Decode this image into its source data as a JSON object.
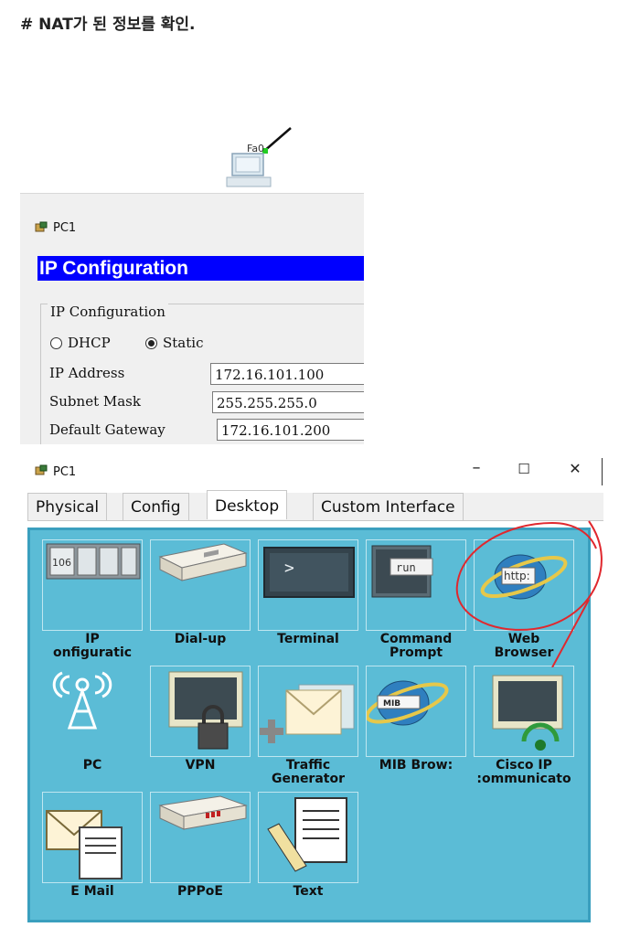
{
  "heading": "# NAT가 된 정보를 확인.",
  "topology": {
    "port_label": "Fa0"
  },
  "ip_window": {
    "title": "PC1",
    "banner": "IP Configuration",
    "group_label": "IP Configuration",
    "dhcp_label": "DHCP",
    "static_label": "Static",
    "mode_selected": "Static",
    "fields": [
      {
        "label": "IP Address",
        "value": "172.16.101.100"
      },
      {
        "label": "Subnet Mask",
        "value": "255.255.255.0"
      },
      {
        "label": "Default Gateway",
        "value": "172.16.101.200"
      }
    ]
  },
  "desktop_window": {
    "title": "PC1",
    "controls": {
      "minimize": "–",
      "maximize": "☐",
      "close": "✕"
    },
    "tabs": [
      {
        "label": "Physical"
      },
      {
        "label": "Config"
      },
      {
        "label": "Desktop"
      },
      {
        "label": "Custom Interface"
      }
    ],
    "active_tab": "Desktop",
    "apps": [
      {
        "label": "IP\nonfiguratic",
        "icon": "ip-configuration-icon"
      },
      {
        "label": "Dial-up",
        "icon": "dial-up-icon"
      },
      {
        "label": "Terminal",
        "icon": "terminal-icon"
      },
      {
        "label": "Command\nPrompt",
        "icon": "command-prompt-icon"
      },
      {
        "label": "Web\nBrowser",
        "icon": "web-browser-icon"
      },
      {
        "label": "PC",
        "icon": "pc-wireless-icon"
      },
      {
        "label": "VPN",
        "icon": "vpn-icon"
      },
      {
        "label": "Traffic\nGenerator",
        "icon": "traffic-generator-icon"
      },
      {
        "label": "MIB Brow:",
        "icon": "mib-browser-icon"
      },
      {
        "label": "Cisco IP\n:ommunicato",
        "icon": "cisco-ip-communicator-icon"
      },
      {
        "label": "E Mail",
        "icon": "email-icon"
      },
      {
        "label": "PPPoE",
        "icon": "pppoe-icon"
      },
      {
        "label": "Text",
        "icon": "text-editor-icon"
      }
    ]
  },
  "colors": {
    "banner": "#0000ff",
    "desktop_bg": "#5bbcd6",
    "annotation": "#e0282e"
  }
}
